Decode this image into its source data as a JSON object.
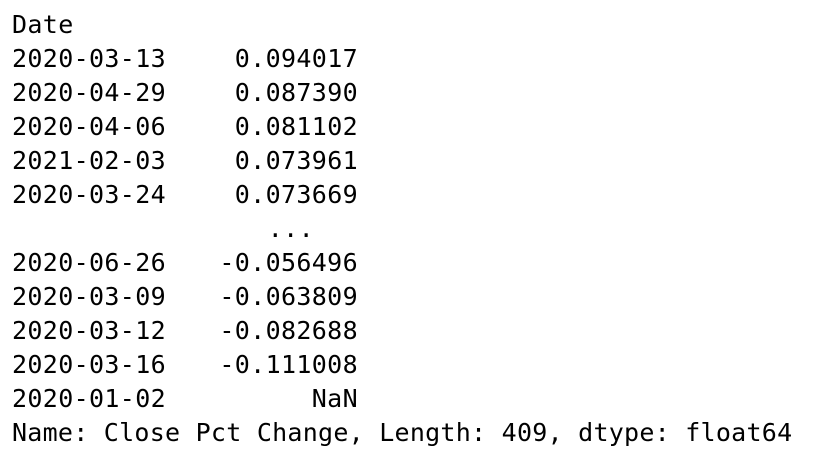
{
  "header": "Date",
  "rows_top": [
    {
      "date": "2020-03-13",
      "value": "0.094017"
    },
    {
      "date": "2020-04-29",
      "value": "0.087390"
    },
    {
      "date": "2020-04-06",
      "value": "0.081102"
    },
    {
      "date": "2021-02-03",
      "value": "0.073961"
    },
    {
      "date": "2020-03-24",
      "value": "0.073669"
    }
  ],
  "ellipsis": "...",
  "rows_bottom": [
    {
      "date": "2020-06-26",
      "value": "-0.056496"
    },
    {
      "date": "2020-03-09",
      "value": "-0.063809"
    },
    {
      "date": "2020-03-12",
      "value": "-0.082688"
    },
    {
      "date": "2020-03-16",
      "value": "-0.111008"
    },
    {
      "date": "2020-01-02",
      "value": "NaN"
    }
  ],
  "footer": "Name: Close Pct Change, Length: 409, dtype: float64"
}
